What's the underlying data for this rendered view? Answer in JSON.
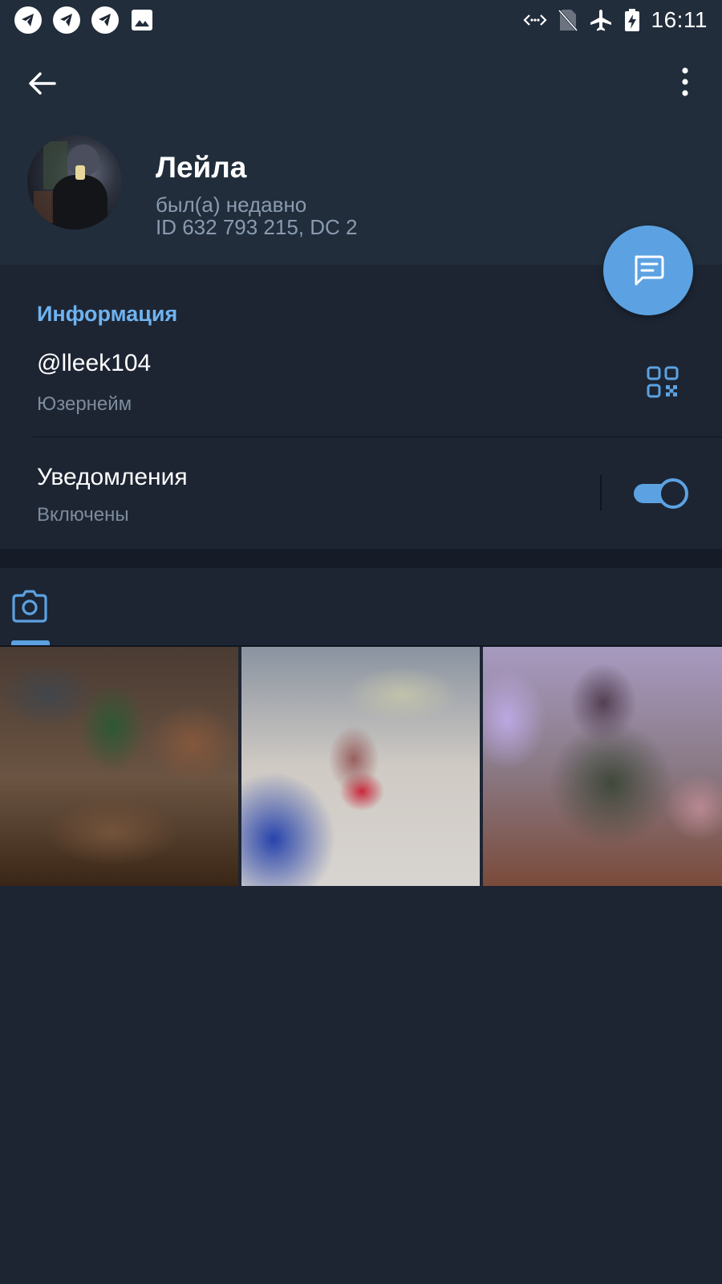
{
  "status_bar": {
    "time": "16:11",
    "left_icons": [
      "telegram-notification-icon",
      "telegram-notification-icon",
      "telegram-notification-icon",
      "image-notification-icon"
    ],
    "right_icons": [
      "data-arrows-icon",
      "no-sim-icon",
      "airplane-mode-icon",
      "battery-charging-icon"
    ]
  },
  "header": {
    "back_icon": "arrow-left-icon",
    "menu_icon": "more-vertical-icon"
  },
  "profile": {
    "name": "Лейла",
    "status": "был(а) недавно",
    "id_line": "ID 632 793 215, DC 2"
  },
  "fab": {
    "icon": "message-icon"
  },
  "info": {
    "title": "Информация",
    "username": "@lleek104",
    "username_label": "Юзернейм",
    "qr_icon": "qr-code-icon",
    "notifications": "Уведомления",
    "notifications_state": "Включены",
    "notifications_enabled": true
  },
  "media": {
    "tabs": [
      {
        "icon": "camera-icon",
        "active": true
      }
    ],
    "thumbnails": [
      "photo-1",
      "photo-2",
      "photo-3"
    ]
  },
  "colors": {
    "accent": "#5ca2e2",
    "section_title": "#6fb3f0",
    "header_bg": "#212d3b",
    "body_bg": "#1d2533",
    "secondary_text": "#8a9bb0"
  }
}
